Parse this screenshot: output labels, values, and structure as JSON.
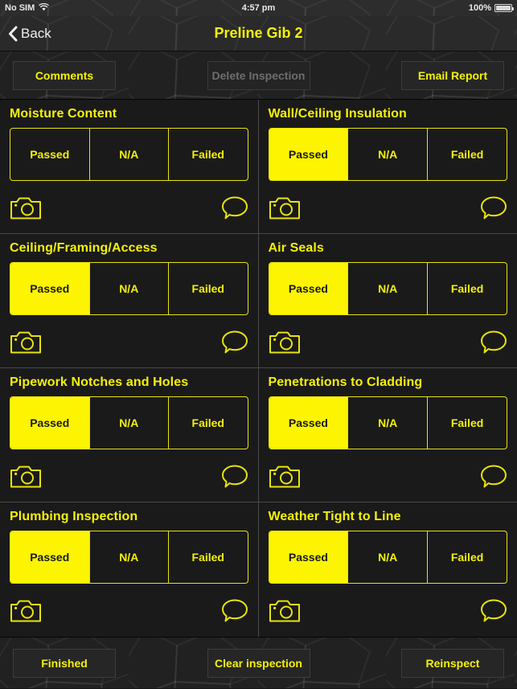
{
  "status_bar": {
    "carrier": "No SIM",
    "wifi_icon": "wifi-icon",
    "time": "4:57 pm",
    "battery_percent": "100%",
    "battery_icon": "battery-full-icon"
  },
  "nav": {
    "back_label": "Back",
    "back_icon": "chevron-left-icon",
    "title": "Preline Gib 2"
  },
  "toolbar": {
    "comments_label": "Comments",
    "delete_label": "Delete Inspection",
    "delete_disabled": true,
    "email_label": "Email Report"
  },
  "segment_options": [
    "Passed",
    "N/A",
    "Failed"
  ],
  "icons": {
    "camera": "camera-icon",
    "comment": "speech-bubble-icon"
  },
  "inspections": [
    {
      "title": "Moisture Content",
      "selected": null
    },
    {
      "title": "Wall/Ceiling Insulation",
      "selected": "Passed"
    },
    {
      "title": "Ceiling/Framing/Access",
      "selected": "Passed"
    },
    {
      "title": "Air Seals",
      "selected": "Passed"
    },
    {
      "title": "Pipework Notches and Holes",
      "selected": "Passed"
    },
    {
      "title": "Penetrations to Cladding",
      "selected": "Passed"
    },
    {
      "title": "Plumbing Inspection",
      "selected": "Passed"
    },
    {
      "title": "Weather Tight to Line",
      "selected": "Passed"
    }
  ],
  "bottom_bar": {
    "finished_label": "Finished",
    "clear_label": "Clear inspection",
    "reinspect_label": "Reinspect"
  },
  "colors": {
    "accent_yellow": "#f5f10a",
    "selected_fill": "#fcf400",
    "background_dark": "#1a1a1a",
    "disabled_text": "#6e6e6e"
  }
}
